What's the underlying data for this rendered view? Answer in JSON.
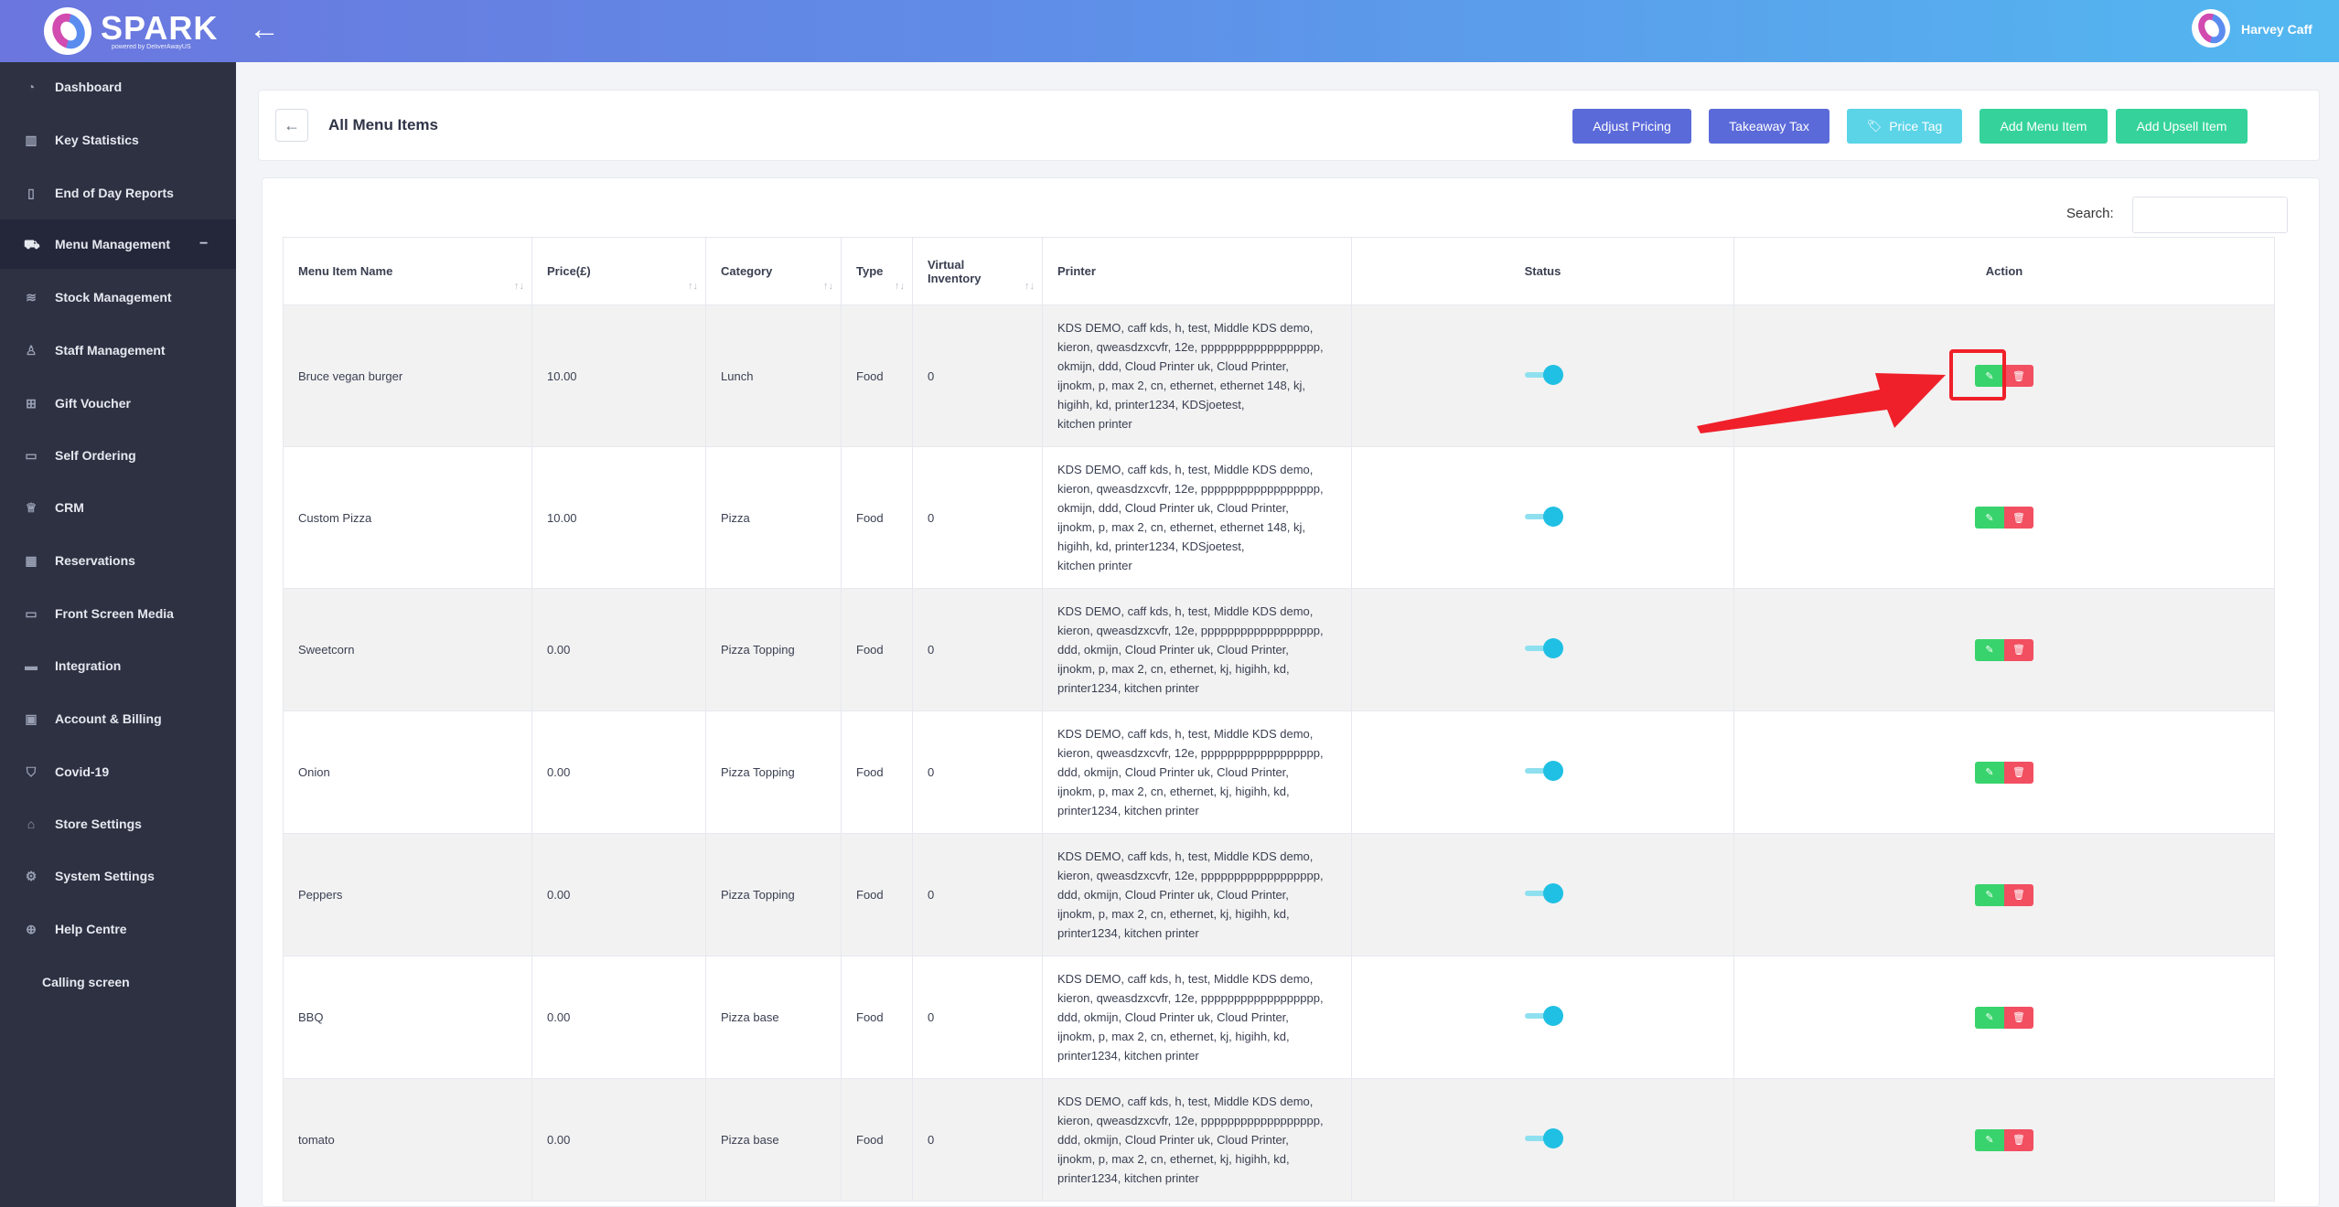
{
  "app": {
    "brand": "SPARK",
    "brand_sub": "powered by DeliverAwayUS",
    "back_icon": "arrow-left-icon",
    "user_name": "Harvey Caff"
  },
  "sidebar": {
    "items": [
      {
        "label": "Dashboard",
        "icon": "dashboard-icon"
      },
      {
        "label": "Key Statistics",
        "icon": "bar-chart-icon"
      },
      {
        "label": "End of Day Reports",
        "icon": "report-icon"
      },
      {
        "label": "Menu Management",
        "icon": "cart-icon",
        "active": true,
        "toggle": "−"
      },
      {
        "label": "Stock Management",
        "icon": "database-icon"
      },
      {
        "label": "Staff Management",
        "icon": "user-icon"
      },
      {
        "label": "Gift Voucher",
        "icon": "gift-icon"
      },
      {
        "label": "Self Ordering",
        "icon": "tablet-icon"
      },
      {
        "label": "CRM",
        "icon": "crown-icon"
      },
      {
        "label": "Reservations",
        "icon": "calendar-icon"
      },
      {
        "label": "Front Screen Media",
        "icon": "laptop-icon"
      },
      {
        "label": "Integration",
        "icon": "credit-card-icon"
      },
      {
        "label": "Account & Billing",
        "icon": "billing-icon"
      },
      {
        "label": "Covid-19",
        "icon": "shield-icon"
      },
      {
        "label": "Store Settings",
        "icon": "home-icon"
      },
      {
        "label": "System Settings",
        "icon": "gear-icon"
      },
      {
        "label": "Help Centre",
        "icon": "globe-icon"
      },
      {
        "label": "Calling screen",
        "icon": ""
      }
    ]
  },
  "header": {
    "title": "All Menu Items",
    "buttons": {
      "adjust_pricing": "Adjust Pricing",
      "takeaway_tax": "Takeaway Tax",
      "price_tag": "Price Tag",
      "add_menu_item": "Add Menu Item",
      "add_upsell_item": "Add Upsell Item"
    }
  },
  "search": {
    "label": "Search:",
    "value": ""
  },
  "table": {
    "columns": {
      "name": "Menu Item Name",
      "price": "Price(£)",
      "category": "Category",
      "type": "Type",
      "virtual_inventory_1": "Virtual",
      "virtual_inventory_2": "Inventory",
      "printer": "Printer",
      "status": "Status",
      "action": "Action"
    },
    "rows": [
      {
        "name": "Bruce vegan burger",
        "price": "10.00",
        "category": "Lunch",
        "type": "Food",
        "inventory": "0",
        "printer": [
          "KDS DEMO, caff kds, h, test, Middle KDS demo,",
          "kieron, qweasdzxcvfr, 12e, pppppppppppppppppp,",
          "okmijn, ddd, Cloud Printer uk, Cloud Printer,",
          "ijnokm, p, max 2, cn, ethernet, ethernet 148, kj,",
          "higihh, kd, printer1234, KDSjoetest,",
          "kitchen printer"
        ],
        "status": true
      },
      {
        "name": "Custom Pizza",
        "price": "10.00",
        "category": "Pizza",
        "type": "Food",
        "inventory": "0",
        "printer": [
          "KDS DEMO, caff kds, h, test, Middle KDS demo,",
          "kieron, qweasdzxcvfr, 12e, pppppppppppppppppp,",
          "okmijn, ddd, Cloud Printer uk, Cloud Printer,",
          "ijnokm, p, max 2, cn, ethernet, ethernet 148, kj,",
          "higihh, kd, printer1234, KDSjoetest,",
          "kitchen printer"
        ],
        "status": true
      },
      {
        "name": "Sweetcorn",
        "price": "0.00",
        "category": "Pizza Topping",
        "type": "Food",
        "inventory": "0",
        "printer": [
          "KDS DEMO, caff kds, h, test, Middle KDS demo,",
          "kieron, qweasdzxcvfr, 12e, pppppppppppppppppp,",
          "ddd, okmijn, Cloud Printer uk, Cloud Printer,",
          "ijnokm, p, max 2, cn, ethernet, kj, higihh, kd,",
          "printer1234, kitchen printer"
        ],
        "status": true
      },
      {
        "name": "Onion",
        "price": "0.00",
        "category": "Pizza Topping",
        "type": "Food",
        "inventory": "0",
        "printer": [
          "KDS DEMO, caff kds, h, test, Middle KDS demo,",
          "kieron, qweasdzxcvfr, 12e, pppppppppppppppppp,",
          "ddd, okmijn, Cloud Printer uk, Cloud Printer,",
          "ijnokm, p, max 2, cn, ethernet, kj, higihh, kd,",
          "printer1234, kitchen printer"
        ],
        "status": true
      },
      {
        "name": "Peppers",
        "price": "0.00",
        "category": "Pizza Topping",
        "type": "Food",
        "inventory": "0",
        "printer": [
          "KDS DEMO, caff kds, h, test, Middle KDS demo,",
          "kieron, qweasdzxcvfr, 12e, pppppppppppppppppp,",
          "ddd, okmijn, Cloud Printer uk, Cloud Printer,",
          "ijnokm, p, max 2, cn, ethernet, kj, higihh, kd,",
          "printer1234, kitchen printer"
        ],
        "status": true
      },
      {
        "name": "BBQ",
        "price": "0.00",
        "category": "Pizza base",
        "type": "Food",
        "inventory": "0",
        "printer": [
          "KDS DEMO, caff kds, h, test, Middle KDS demo,",
          "kieron, qweasdzxcvfr, 12e, pppppppppppppppppp,",
          "ddd, okmijn, Cloud Printer uk, Cloud Printer,",
          "ijnokm, p, max 2, cn, ethernet, kj, higihh, kd,",
          "printer1234, kitchen printer"
        ],
        "status": true
      },
      {
        "name": "tomato",
        "price": "0.00",
        "category": "Pizza base",
        "type": "Food",
        "inventory": "0",
        "printer": [
          "KDS DEMO, caff kds, h, test, Middle KDS demo,",
          "kieron, qweasdzxcvfr, 12e, pppppppppppppppppp,",
          "ddd, okmijn, Cloud Printer uk, Cloud Printer,",
          "ijnokm, p, max 2, cn, ethernet, kj, higihh, kd,",
          "printer1234, kitchen printer"
        ],
        "status": true
      }
    ]
  },
  "colors": {
    "accent_blue": "#5b6ad9",
    "accent_cyan": "#5bd4e8",
    "accent_green": "#35d39b",
    "edit_green": "#38d36c",
    "delete_red": "#f24f61",
    "annotation_red": "#f0202a",
    "sidebar_bg": "#2d3142"
  }
}
